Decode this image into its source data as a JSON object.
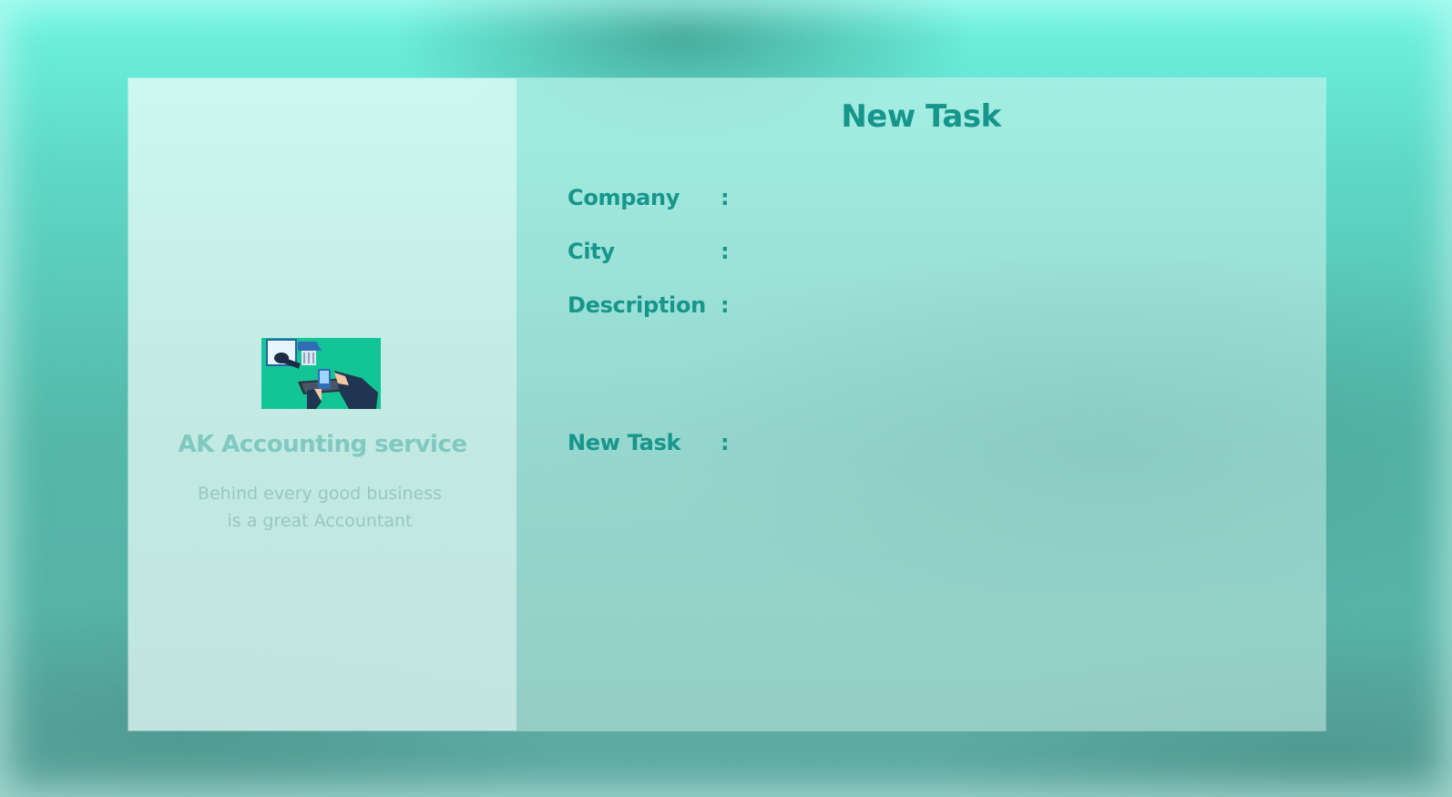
{
  "brand": {
    "name": "AK Accounting service",
    "tagline_line1": "Behind every good business",
    "tagline_line2": "is a great Accountant",
    "logo_icon": "accounting-illustration-icon"
  },
  "form": {
    "title": "New Task",
    "fields": [
      {
        "label": "Company",
        "colon": ":",
        "value": ""
      },
      {
        "label": "City",
        "colon": ":",
        "value": ""
      },
      {
        "label": "Description",
        "colon": ":",
        "value": ""
      },
      {
        "label": "New Task",
        "colon": ":",
        "value": ""
      }
    ]
  },
  "colors": {
    "accent": "#16958b",
    "logo_bg": "#13c596",
    "brand_text": "#7fc9c1"
  }
}
